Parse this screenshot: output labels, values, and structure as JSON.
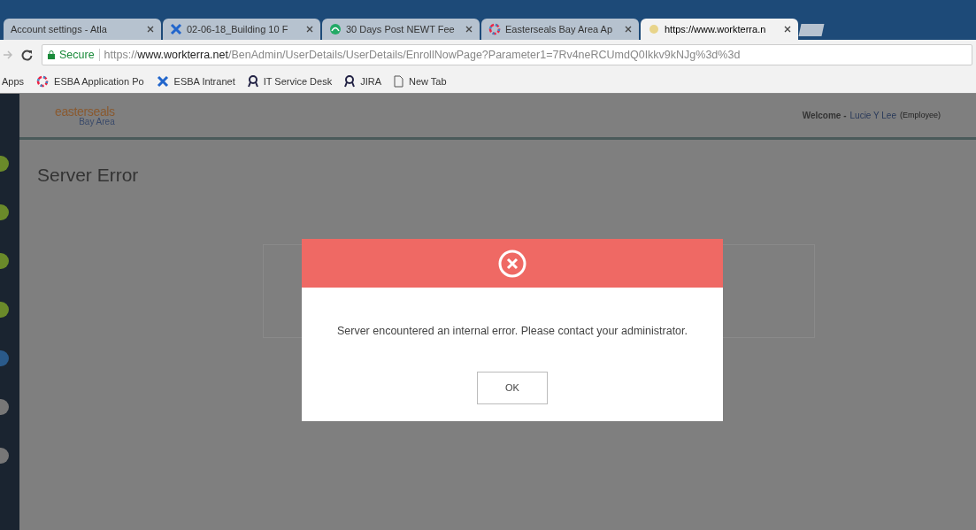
{
  "tabs": [
    {
      "title": "Account settings - Atla",
      "kind": "none",
      "selected": false
    },
    {
      "title": "02-06-18_Building 10 F",
      "kind": "cross",
      "selected": false
    },
    {
      "title": "30 Days Post NEWT Fee",
      "kind": "green",
      "selected": false
    },
    {
      "title": "Easterseals Bay Area Ap",
      "kind": "ring",
      "selected": false
    },
    {
      "title": "https://www.workterra.n",
      "kind": "sun",
      "selected": true
    }
  ],
  "address_bar": {
    "secure_label": "Secure",
    "scheme": "https://",
    "domain": "www.workterra.net",
    "path": "/BenAdmin/UserDetails/UserDetails/EnrollNowPage?Parameter1=7Rv4neRCUmdQ0Ikkv9kNJg%3d%3d"
  },
  "bookmarks": [
    {
      "label": "Apps",
      "kind": "none"
    },
    {
      "label": "ESBA Application Po",
      "kind": "ring"
    },
    {
      "label": "ESBA Intranet",
      "kind": "cross"
    },
    {
      "label": "IT Service Desk",
      "kind": "badge"
    },
    {
      "label": "JIRA",
      "kind": "badge"
    },
    {
      "label": "New Tab",
      "kind": "page"
    }
  ],
  "header": {
    "logo_top": "easterseals",
    "logo_bottom": "Bay Area",
    "welcome": "Welcome -",
    "user": "Lucie Y Lee",
    "role": "(Employee)"
  },
  "page_title": "Server Error",
  "dialog": {
    "message": "Server encountered an internal error. Please contact your administrator.",
    "button": "OK"
  }
}
